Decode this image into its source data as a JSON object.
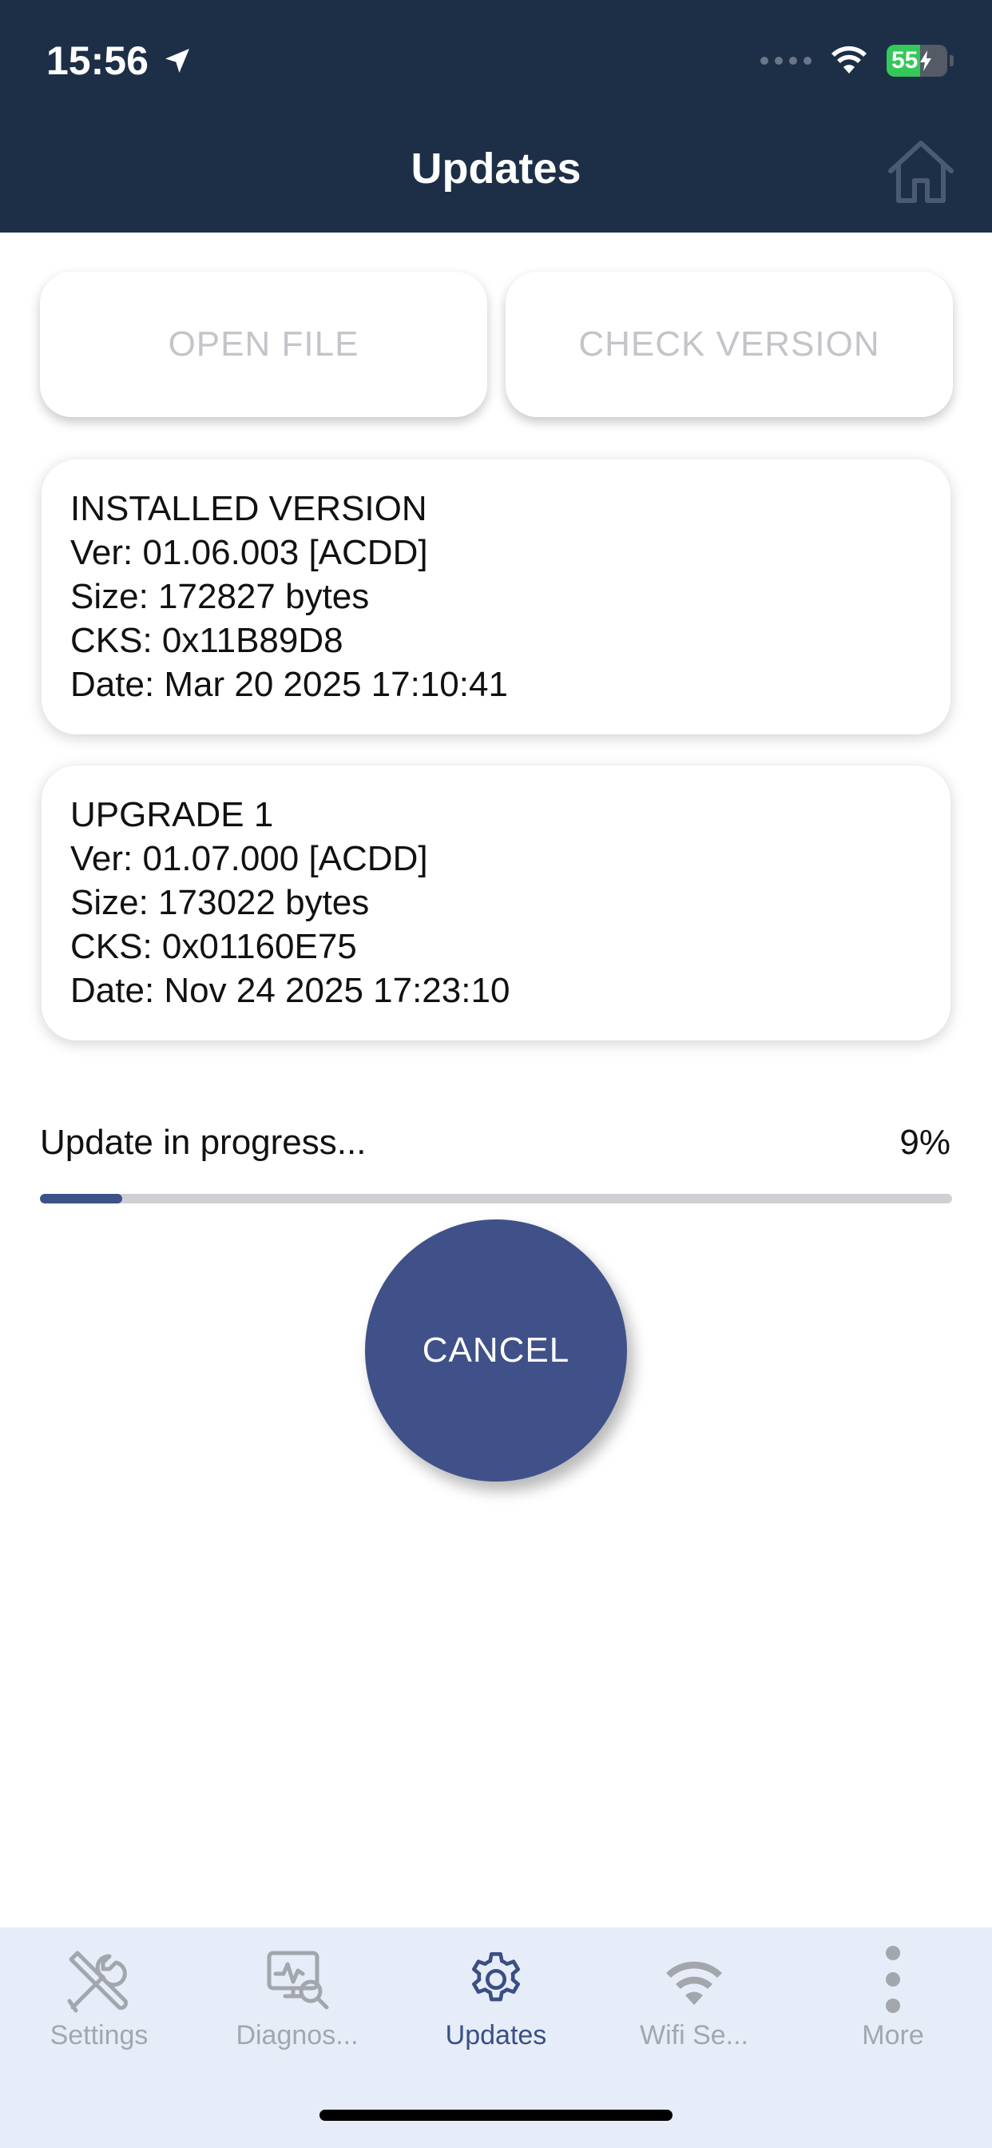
{
  "status_bar": {
    "time": "15:56",
    "battery": "55"
  },
  "header": {
    "title": "Updates"
  },
  "buttons": {
    "open_file": "OPEN FILE",
    "check_version": "CHECK VERSION",
    "cancel": "CANCEL"
  },
  "installed": {
    "title": "INSTALLED VERSION",
    "ver": "Ver: 01.06.003 [ACDD]",
    "size": "Size: 172827 bytes",
    "cks": "CKS: 0x11B89D8",
    "date": "Date: Mar 20 2025 17:10:41"
  },
  "upgrade": {
    "title": "UPGRADE 1",
    "ver": "Ver: 01.07.000 [ACDD]",
    "size": "Size: 173022 bytes",
    "cks": "CKS: 0x01160E75",
    "date": "Date: Nov 24 2025 17:23:10"
  },
  "progress": {
    "label": "Update in progress...",
    "percent_text": "9%",
    "value": 0.09
  },
  "tabs": [
    {
      "label": "Settings",
      "icon": "tools-icon",
      "active": false
    },
    {
      "label": "Diagnos...",
      "icon": "diagnostics-icon",
      "active": false
    },
    {
      "label": "Updates",
      "icon": "gear-icon",
      "active": true
    },
    {
      "label": "Wifi Se...",
      "icon": "wifi-icon",
      "active": false
    },
    {
      "label": "More",
      "icon": "more-icon",
      "active": false
    }
  ],
  "colors": {
    "header_bg": "#1c2f47",
    "accent": "#3f5188",
    "tab_inactive": "#a3a7ad",
    "tab_active": "#3b4f85"
  }
}
